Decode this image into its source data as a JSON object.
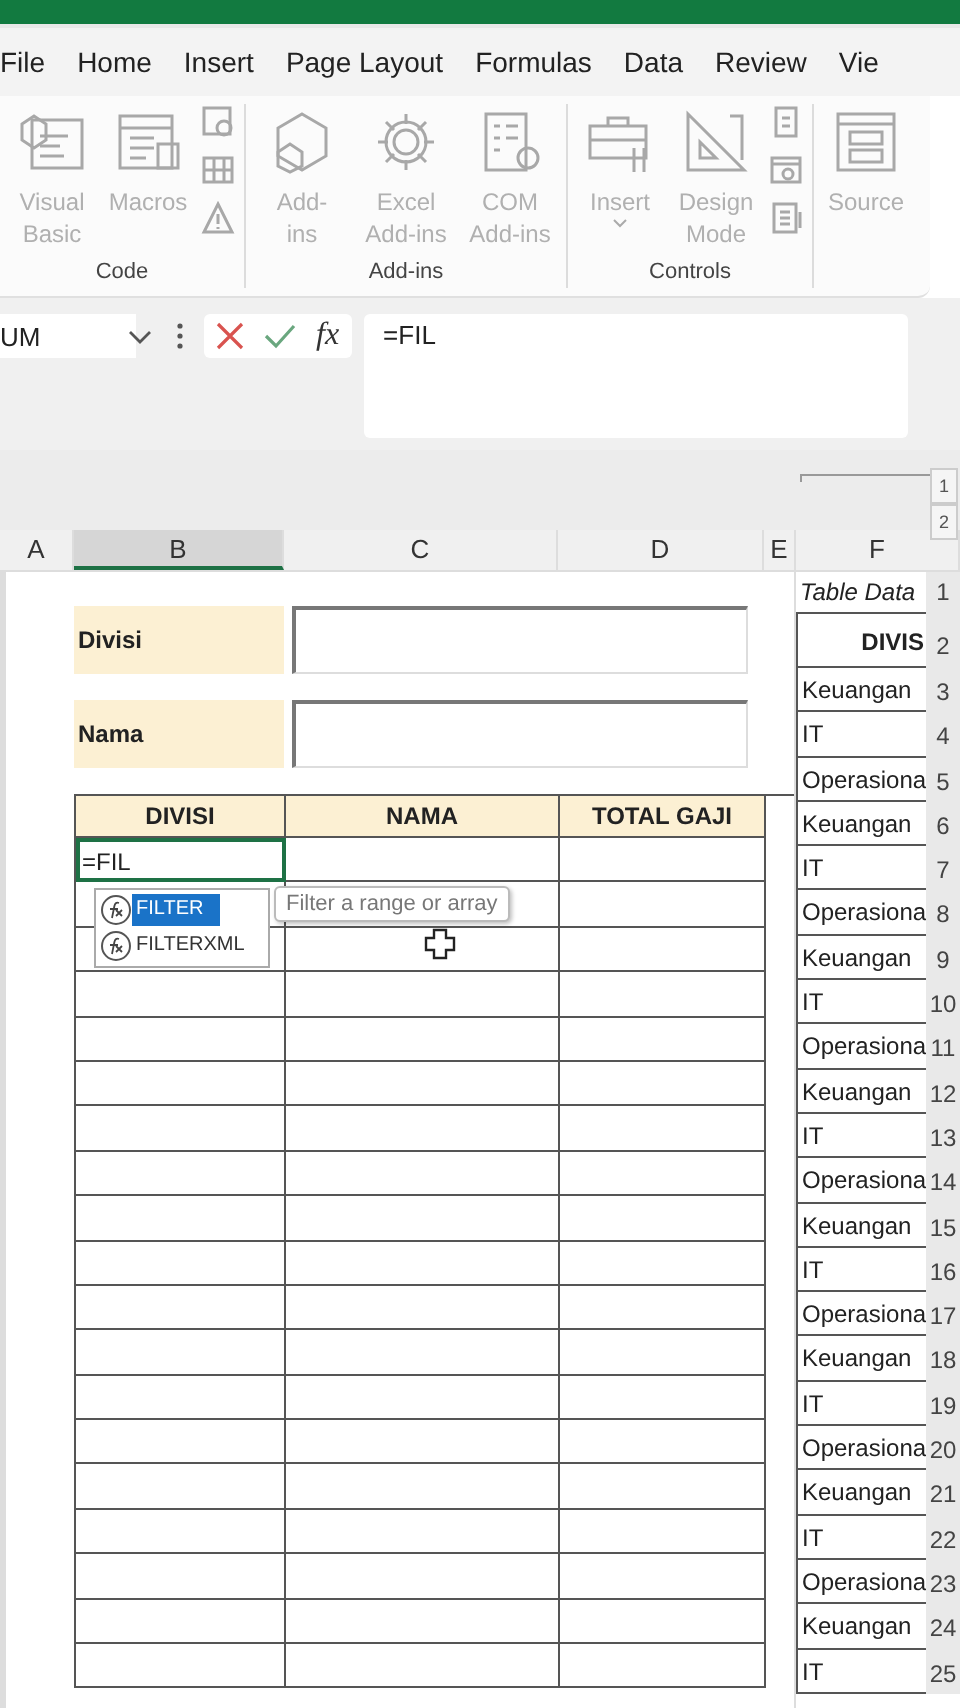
{
  "tabs": [
    {
      "label": "File"
    },
    {
      "label": "Home"
    },
    {
      "label": "Insert"
    },
    {
      "label": "Page Layout"
    },
    {
      "label": "Formulas"
    },
    {
      "label": "Data"
    },
    {
      "label": "Review"
    },
    {
      "label": "Vie"
    }
  ],
  "ribbon": {
    "groups": [
      {
        "label": "Code",
        "buttons": [
          {
            "kind": "large",
            "label": "Visual Basic"
          },
          {
            "kind": "large",
            "label": "Macros"
          },
          {
            "kind": "stack"
          }
        ]
      },
      {
        "label": "Add-ins",
        "buttons": [
          {
            "kind": "large",
            "label": "Add-ins"
          },
          {
            "kind": "large",
            "label": "Excel Add-ins"
          },
          {
            "kind": "large",
            "label": "COM Add-ins"
          }
        ]
      },
      {
        "label": "Controls",
        "buttons": [
          {
            "kind": "dropdown",
            "label": "Insert"
          },
          {
            "kind": "large",
            "label": "Design Mode"
          },
          {
            "kind": "stack"
          }
        ]
      },
      {
        "buttons": [
          {
            "kind": "large",
            "label": "Source"
          }
        ]
      }
    ]
  },
  "formula_bar": {
    "name_box": "UM",
    "formula": "=FIL",
    "fx": "fx"
  },
  "outline_levels": [
    "1",
    "2"
  ],
  "column_headers": [
    {
      "label": "A",
      "selected": false
    },
    {
      "label": "B",
      "selected": true
    },
    {
      "label": "C",
      "selected": false
    },
    {
      "label": "D",
      "selected": false
    },
    {
      "label": "E",
      "selected": false
    },
    {
      "label": "F",
      "selected": false
    }
  ],
  "form_fields": [
    {
      "label": "Divisi"
    },
    {
      "label": "Nama"
    }
  ],
  "table": {
    "columns": [
      "DIVISI",
      "NAMA",
      "TOTAL GAJI"
    ],
    "editing_cell": "=FIL"
  },
  "autocomplete": {
    "items": [
      {
        "label": "FILTER",
        "selected": true
      },
      {
        "label": "FILTERXML",
        "selected": false
      }
    ],
    "tooltip": "Filter a range or array"
  },
  "data_pane": {
    "title": "Table Data",
    "title_row": "1",
    "header": "DIVIS",
    "header_row": "2",
    "rows": [
      {
        "text": "Keuangan",
        "row": "3"
      },
      {
        "text": "IT",
        "row": "4"
      },
      {
        "text": "Operasiona",
        "row": "5"
      },
      {
        "text": "Keuangan",
        "row": "6"
      },
      {
        "text": "IT",
        "row": "7"
      },
      {
        "text": "Operasiona",
        "row": "8"
      },
      {
        "text": "Keuangan",
        "row": "9"
      },
      {
        "text": "IT",
        "row": "10"
      },
      {
        "text": "Operasiona",
        "row": "11"
      },
      {
        "text": "Keuangan",
        "row": "12"
      },
      {
        "text": "IT",
        "row": "13"
      },
      {
        "text": "Operasiona",
        "row": "14"
      },
      {
        "text": "Keuangan",
        "row": "15"
      },
      {
        "text": "IT",
        "row": "16"
      },
      {
        "text": "Operasiona",
        "row": "17"
      },
      {
        "text": "Keuangan",
        "row": "18"
      },
      {
        "text": "IT",
        "row": "19"
      },
      {
        "text": "Operasiona",
        "row": "20"
      },
      {
        "text": "Keuangan",
        "row": "21"
      },
      {
        "text": "IT",
        "row": "22"
      },
      {
        "text": "Operasiona",
        "row": "23"
      },
      {
        "text": "Keuangan",
        "row": "24"
      },
      {
        "text": "IT",
        "row": "25"
      }
    ]
  }
}
